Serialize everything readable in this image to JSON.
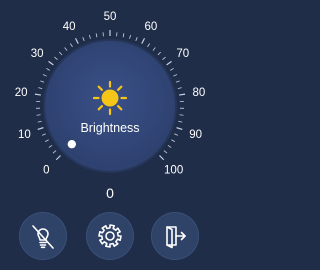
{
  "dial": {
    "label": "Brightness",
    "value": 0,
    "value_text": "0",
    "scale": [
      "0",
      "10",
      "20",
      "30",
      "40",
      "50",
      "60",
      "70",
      "80",
      "90",
      "100"
    ],
    "min": 0,
    "max": 100
  },
  "buttons": [
    {
      "name": "light-off-button",
      "icon": "lightbulb-off-icon"
    },
    {
      "name": "settings-button",
      "icon": "gear-icon"
    },
    {
      "name": "exit-button",
      "icon": "exit-door-icon"
    }
  ],
  "colors": {
    "background": "#1f2d48",
    "dial_face": "#33477a",
    "button": "#2f4268",
    "sun": "#f5c518",
    "text": "#ffffff"
  }
}
